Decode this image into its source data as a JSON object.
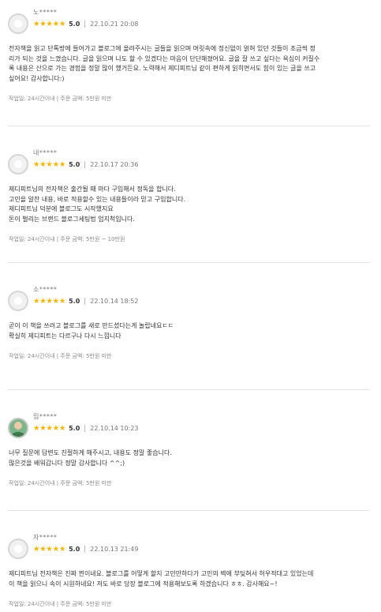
{
  "reviews": [
    {
      "user": "노*****",
      "stars": "★★★★★",
      "score": "5.0",
      "date": "22.10.21 20:08",
      "lines": [
        "전자책을 읽고 단톡방에 들어가고 블로그에 올려주시는 글들을 읽으며 머릿속에 정신없이 얽혀 있던 것들이 조금씩 정",
        "리가 되는 것을 느꼈습니다. 글을 읽으며 나도 할 수 있겠다는 마음이 단단해졌어요. 글을 잘 쓰고 싶다는 욕심이 커질수",
        "록 내용은 산으로 가는 경험을 정말 많이 했거든요. 노력해서 제디피트님 같이 편하게 읽히면서도 힘이 있는 글을 쓰고",
        "싶어요! 감사합니다:)"
      ],
      "footer": "작업일: 24시간이내 | 주문 금액: 5만원 미만",
      "avatar": "default-avatar"
    },
    {
      "user": "내*****",
      "stars": "★★★★★",
      "score": "5.0",
      "date": "22.10.17 20:36",
      "lines": [
        "제디피트님의 전자책은 출간될 때 마다 구입해서 정독을 합니다.",
        "고민을 알찬 내용, 바로 적용할수 있는 내용들이라 믿고 구입합니다.",
        "제디피트님 덕분에 블로그도 시작했지요",
        "돈이 벌리는 브랜드 블로그세팅법 엄지척입니다."
      ],
      "footer": "작업일: 24시간이내 | 주문 금액: 5만원 ~ 10만원",
      "avatar": "default-avatar"
    },
    {
      "user": "소*****",
      "stars": "★★★★★",
      "score": "5.0",
      "date": "22.10.14 18:52",
      "lines": [
        "곧이 이 책을 쓰려고 블로그를 새로 만드셨다는게 놀랍네요ㄷㄷ",
        "확실히 제디피트는 다르구나 다시 느낍니다"
      ],
      "footer": "작업일: 24시간이내 | 주문 금액: 5만원 미만",
      "avatar": "default-avatar"
    },
    {
      "user": "밈*****",
      "stars": "★★★★★",
      "score": "5.0",
      "date": "22.10.14 10:23",
      "lines": [
        "너무 질문에 답변도 친절하게 해주시고, 내용도 정말 좋습니다.",
        "많은것을 배워갑니다 정말 감사합니다 ^^;)"
      ],
      "footer": "작업일: 24시간이내 | 주문 금액: 5만원 미만",
      "avatar": "photo-avatar"
    },
    {
      "user": "자*****",
      "stars": "★★★★★",
      "score": "5.0",
      "date": "22.10.13 21:49",
      "lines": [
        "제디피트님 전자책은 진짜 찐이네요. 블로그를 어떻게 할지 고민만하다가 고민의 벽에 부딪혀서 허우적대고 있었는데",
        "이 책을 읽으니 속이 시원하네요! 저도 바로 당장 블로그에 적용해보도록 하겠습니다 ㅎㅎ. 감사해요~!"
      ],
      "footer": "작업일: 24시간이내 | 주문 금액: 5만원 미만",
      "avatar": "default-avatar"
    }
  ]
}
